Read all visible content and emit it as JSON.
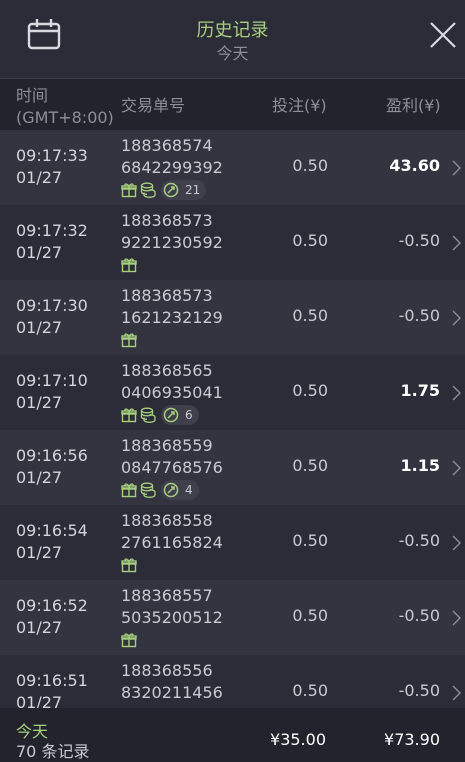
{
  "header": {
    "title": "历史记录",
    "subtitle": "今天",
    "calendar_icon": "calendar-icon",
    "close_icon": "close-icon"
  },
  "columns": {
    "time": "时间\n(GMT+8:00)",
    "order": "交易单号",
    "bet": "投注(¥)",
    "profit": "盈利(¥)"
  },
  "rows": [
    {
      "time": "09:17:33\n01/27",
      "order": "188368574\n6842299392",
      "gift": true,
      "coins": true,
      "spins": "21",
      "bet": "0.50",
      "profit": "43.60",
      "win": true
    },
    {
      "time": "09:17:32\n01/27",
      "order": "188368573\n9221230592",
      "gift": true,
      "coins": false,
      "spins": "",
      "bet": "0.50",
      "profit": "-0.50",
      "win": false
    },
    {
      "time": "09:17:30\n01/27",
      "order": "188368573\n1621232129",
      "gift": true,
      "coins": false,
      "spins": "",
      "bet": "0.50",
      "profit": "-0.50",
      "win": false
    },
    {
      "time": "09:17:10\n01/27",
      "order": "188368565\n0406935041",
      "gift": true,
      "coins": true,
      "spins": "6",
      "bet": "0.50",
      "profit": "1.75",
      "win": true
    },
    {
      "time": "09:16:56\n01/27",
      "order": "188368559\n0847768576",
      "gift": true,
      "coins": true,
      "spins": "4",
      "bet": "0.50",
      "profit": "1.15",
      "win": true
    },
    {
      "time": "09:16:54\n01/27",
      "order": "188368558\n2761165824",
      "gift": true,
      "coins": false,
      "spins": "",
      "bet": "0.50",
      "profit": "-0.50",
      "win": false
    },
    {
      "time": "09:16:52\n01/27",
      "order": "188368557\n5035200512",
      "gift": true,
      "coins": false,
      "spins": "",
      "bet": "0.50",
      "profit": "-0.50",
      "win": false
    },
    {
      "time": "09:16:51\n01/27",
      "order": "188368556\n8320211456",
      "gift": false,
      "coins": false,
      "spins": "",
      "bet": "0.50",
      "profit": "-0.50",
      "win": false
    }
  ],
  "footer": {
    "period": "今天",
    "count": "70 条记录",
    "total_bet": "¥35.00",
    "total_profit": "¥73.90"
  },
  "colors": {
    "accent_green": "#a7cf7e",
    "background": "#2b2c38",
    "row_alt": "#33343f"
  }
}
